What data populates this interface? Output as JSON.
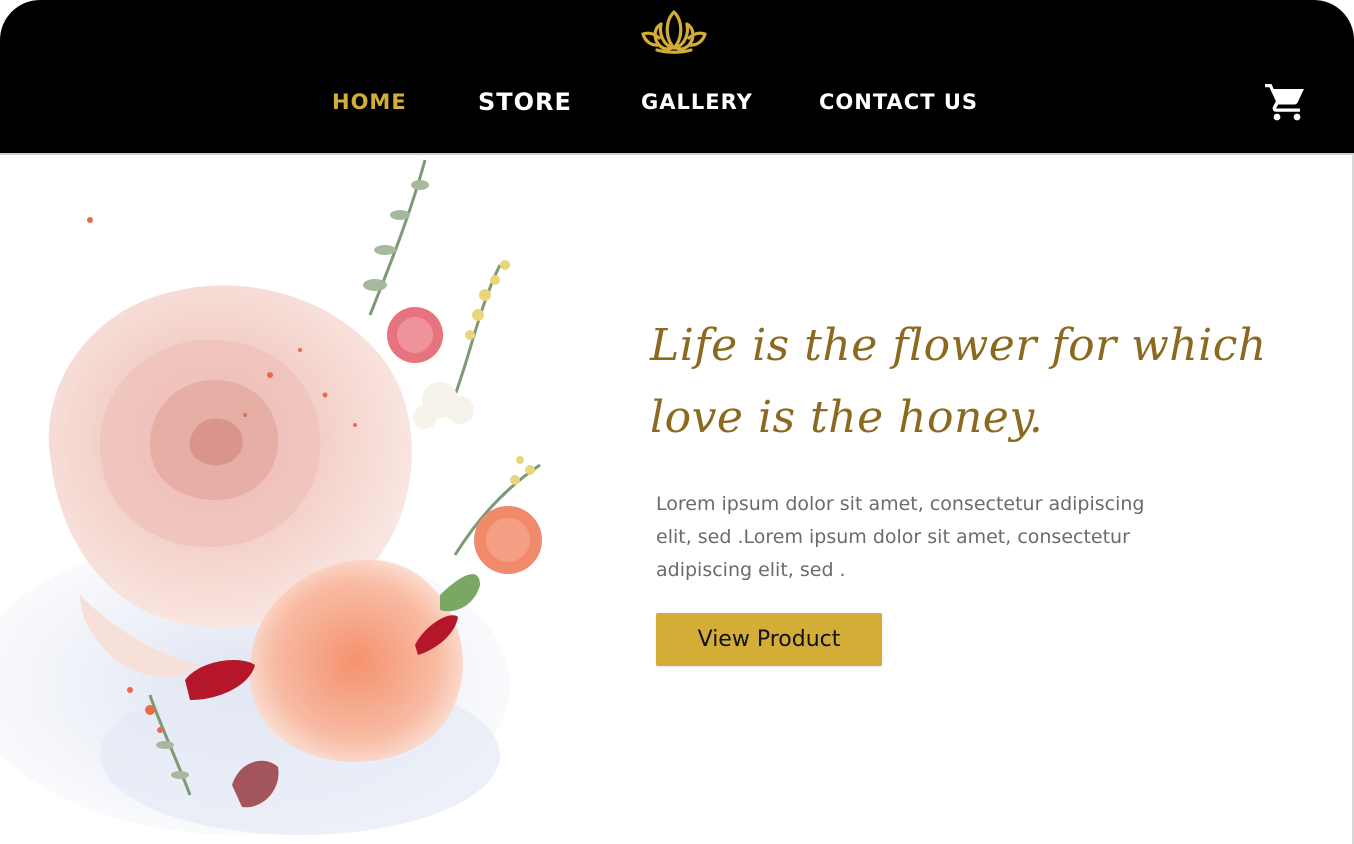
{
  "nav": {
    "items": [
      {
        "label": "HOME",
        "active": true
      },
      {
        "label": "STORE",
        "active": false
      },
      {
        "label": "GALLERY",
        "active": false
      },
      {
        "label": "CONTACT US",
        "active": false
      }
    ],
    "logo_icon": "lotus-icon",
    "cart_icon": "cart-icon"
  },
  "hero": {
    "image": "rose-bouquet-image",
    "quote": "Life is the flower for which love is the honey.",
    "body": "Lorem ipsum dolor sit amet, consectetur adipiscing elit, sed .Lorem ipsum dolor sit amet, consectetur adipiscing elit, sed .",
    "cta_label": "View Product"
  },
  "colors": {
    "nav_background": "#000000",
    "accent_gold": "#d4ad37",
    "quote_gold": "#8b6a1f",
    "body_text": "#6b6b6b",
    "nav_text": "#ffffff"
  }
}
